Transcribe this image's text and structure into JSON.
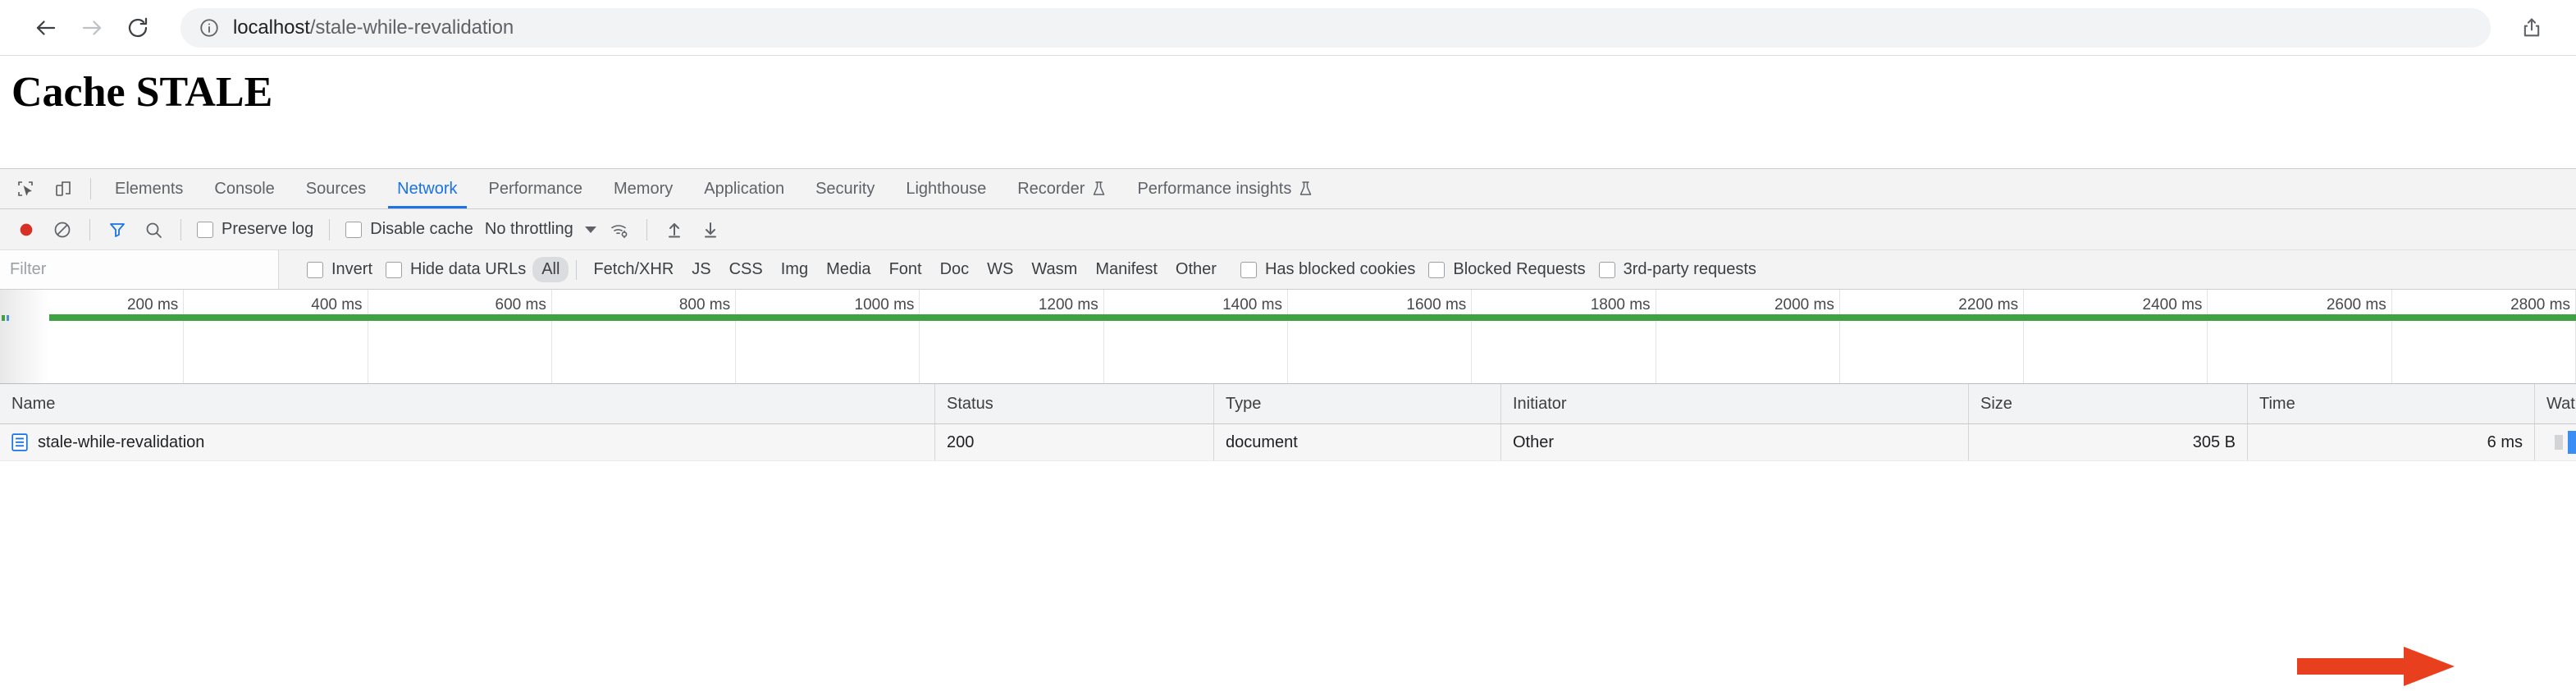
{
  "browser": {
    "back_label": "Back",
    "forward_label": "Forward",
    "reload_label": "Reload",
    "info_icon": "info-circle-icon",
    "share_icon": "share-upload-icon",
    "url_host": "localhost",
    "url_path": "/stale-while-revalidation"
  },
  "page": {
    "heading": "Cache STALE"
  },
  "devtools": {
    "inspect_icon": "cursor-select-icon",
    "device_icon": "device-toolbar-icon",
    "tabs": [
      {
        "label": "Elements",
        "active": false,
        "beaker": false
      },
      {
        "label": "Console",
        "active": false,
        "beaker": false
      },
      {
        "label": "Sources",
        "active": false,
        "beaker": false
      },
      {
        "label": "Network",
        "active": true,
        "beaker": false
      },
      {
        "label": "Performance",
        "active": false,
        "beaker": false
      },
      {
        "label": "Memory",
        "active": false,
        "beaker": false
      },
      {
        "label": "Application",
        "active": false,
        "beaker": false
      },
      {
        "label": "Security",
        "active": false,
        "beaker": false
      },
      {
        "label": "Lighthouse",
        "active": false,
        "beaker": false
      },
      {
        "label": "Recorder",
        "active": false,
        "beaker": true
      },
      {
        "label": "Performance insights",
        "active": false,
        "beaker": true
      }
    ],
    "toolbar": {
      "record_icon": "record-circle-icon",
      "clear_icon": "clear-no-entry-icon",
      "filter_icon": "filter-funnel-icon",
      "search_icon": "search-magnifier-icon",
      "preserve_log_label": "Preserve log",
      "preserve_log_checked": false,
      "disable_cache_label": "Disable cache",
      "disable_cache_checked": false,
      "throttling_value": "No throttling",
      "network_conditions_icon": "wifi-gear-icon",
      "import_icon": "import-up-arrow-icon",
      "export_icon": "export-down-arrow-icon"
    },
    "filterbar": {
      "filter_placeholder": "Filter",
      "filter_value": "",
      "invert_label": "Invert",
      "invert_checked": false,
      "hide_data_urls_label": "Hide data URLs",
      "hide_data_urls_checked": false,
      "types": [
        {
          "label": "All",
          "active": true
        },
        {
          "label": "Fetch/XHR",
          "active": false
        },
        {
          "label": "JS",
          "active": false
        },
        {
          "label": "CSS",
          "active": false
        },
        {
          "label": "Img",
          "active": false
        },
        {
          "label": "Media",
          "active": false
        },
        {
          "label": "Font",
          "active": false
        },
        {
          "label": "Doc",
          "active": false
        },
        {
          "label": "WS",
          "active": false
        },
        {
          "label": "Wasm",
          "active": false
        },
        {
          "label": "Manifest",
          "active": false
        },
        {
          "label": "Other",
          "active": false
        }
      ],
      "has_blocked_cookies_label": "Has blocked cookies",
      "has_blocked_cookies_checked": false,
      "blocked_requests_label": "Blocked Requests",
      "blocked_requests_checked": false,
      "third_party_label": "3rd-party requests",
      "third_party_checked": false
    },
    "timeline": {
      "ticks": [
        "200 ms",
        "400 ms",
        "600 ms",
        "800 ms",
        "1000 ms",
        "1200 ms",
        "1400 ms",
        "1600 ms",
        "1800 ms",
        "2000 ms",
        "2200 ms",
        "2400 ms",
        "2600 ms",
        "2800 ms"
      ],
      "load_color": "#3fa142",
      "dom_content_loaded_color": "#b8312f"
    },
    "table": {
      "columns": [
        "Name",
        "Status",
        "Type",
        "Initiator",
        "Size",
        "Time",
        "Waterfall"
      ],
      "waterfall_header_truncated": "Wat",
      "rows": [
        {
          "icon": "document-file-icon",
          "name": "stale-while-revalidation",
          "status": "200",
          "type": "document",
          "initiator": "Other",
          "size": "305 B",
          "time": "6 ms"
        }
      ]
    }
  },
  "annotation": {
    "arrow_color": "#e8401f",
    "points_at": "6 ms"
  }
}
